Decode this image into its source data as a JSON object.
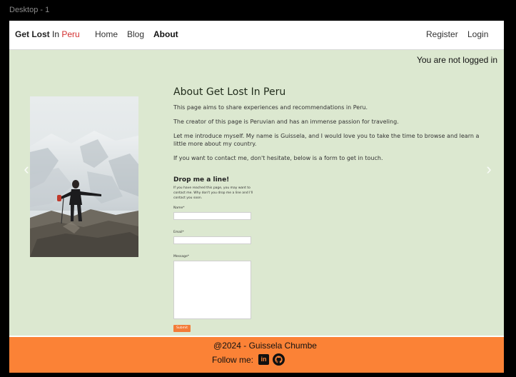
{
  "frame": {
    "label": "Desktop - 1"
  },
  "navbar": {
    "brand": {
      "part1": "Get Lost",
      "part2": " In ",
      "part3": "Peru"
    },
    "links": [
      {
        "label": "Home",
        "active": false
      },
      {
        "label": "Blog",
        "active": false
      },
      {
        "label": "About",
        "active": true
      }
    ],
    "auth": {
      "register": "Register",
      "login": "Login"
    }
  },
  "status": {
    "login_message": "You are not logged in"
  },
  "carousel": {
    "image_icon": "hiker-photo",
    "prev_icon": "chevron-left-icon",
    "next_icon": "chevron-right-icon"
  },
  "about": {
    "title": "About Get Lost In Peru",
    "paragraphs": [
      "This page aims to share experiences and recommendations in Peru.",
      "The creator of this page is Peruvian and has an immense passion for traveling.",
      "Let me introduce myself. My name is Guissela, and I would love you to take the time to browse and learn a little more about my country.",
      "If you want to contact me, don't hesitate, below is a form to get in touch."
    ]
  },
  "contact_form": {
    "title": "Drop me a line!",
    "intro": "If you have reached this page, you may want to contact me. Why don't you drop me a line and I'll contact you soon.",
    "name_label": "Name*",
    "email_label": "Email*",
    "message_label": "Message*",
    "submit_label": "Submit"
  },
  "footer": {
    "copyright": "@2024 - Guissela Chumbe",
    "follow_label": "Follow me:",
    "linkedin_text": "in",
    "social_icons": [
      "linkedin-icon",
      "github-icon"
    ]
  },
  "colors": {
    "page_bg": "#dce8d0",
    "footer_bg": "#fb8236",
    "brand_accent": "#d32f2f",
    "submit_bg": "#f37c38"
  }
}
